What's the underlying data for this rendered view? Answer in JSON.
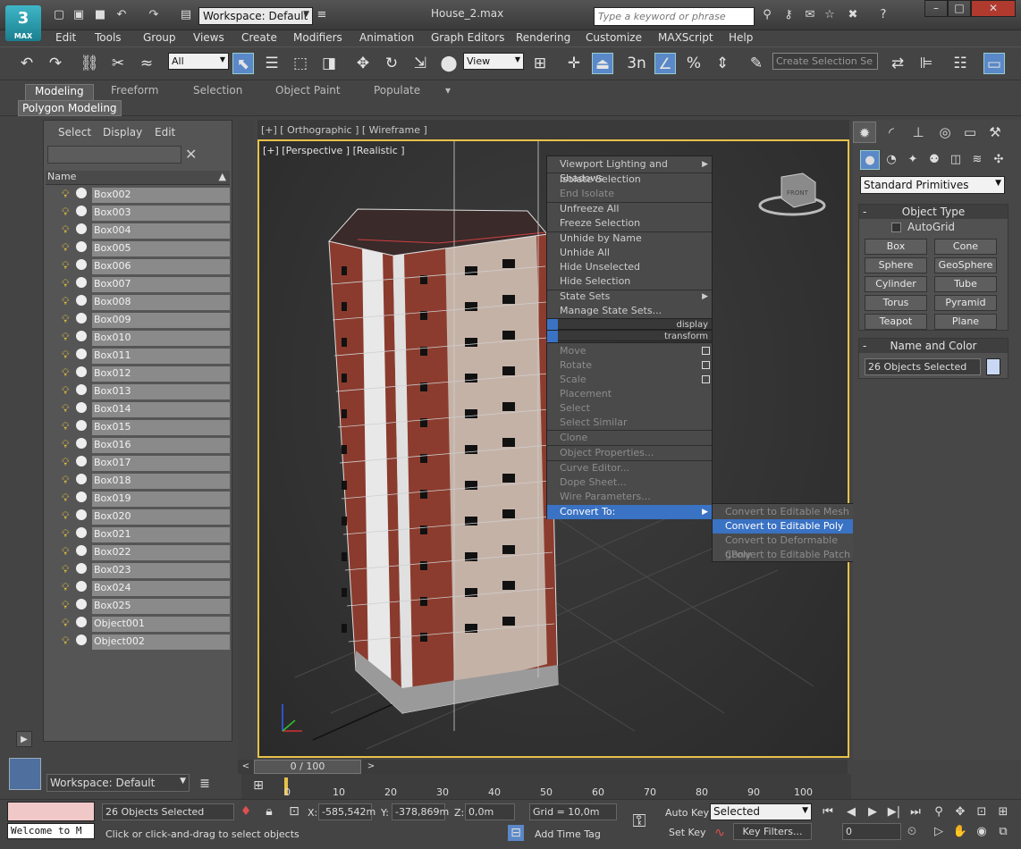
{
  "app": {
    "logo_text": "3",
    "logo_sub": "MAX",
    "workspace": "Workspace: Default",
    "document_title": "House_2.max",
    "search_placeholder": "Type a keyword or phrase",
    "colors": {
      "accent": "#5a88c8",
      "viewport_border": "#e8c14a",
      "menu_highlight": "#3a72c4"
    }
  },
  "menu": [
    "Edit",
    "Tools",
    "Group",
    "Views",
    "Create",
    "Modifiers",
    "Animation",
    "Graph Editors",
    "Rendering",
    "Customize",
    "MAXScript",
    "Help"
  ],
  "toolbar": {
    "filter_value": "All",
    "reference_coord": "View",
    "spinner_snap_label": "3n",
    "selection_set_placeholder": "Create Selection Se"
  },
  "ribbon": {
    "tabs": [
      "Modeling",
      "Freeform",
      "Selection",
      "Object Paint",
      "Populate"
    ],
    "active_tab": "Modeling",
    "panel_label": "Polygon Modeling"
  },
  "explorer": {
    "menu": [
      "Select",
      "Display",
      "Edit"
    ],
    "column_header": "Name",
    "items": [
      "Box002",
      "Box003",
      "Box004",
      "Box005",
      "Box006",
      "Box007",
      "Box008",
      "Box009",
      "Box010",
      "Box011",
      "Box012",
      "Box013",
      "Box014",
      "Box015",
      "Box016",
      "Box017",
      "Box018",
      "Box019",
      "Box020",
      "Box021",
      "Box022",
      "Box023",
      "Box024",
      "Box025",
      "Object001",
      "Object002"
    ],
    "workspace": "Workspace: Default"
  },
  "viewports": {
    "top_label": "[+] [ Orthographic ] [ Wireframe ]",
    "main_label": "[+] [Perspective ] [Realistic ]",
    "viewcube_text": "FRONT"
  },
  "quad_menu": {
    "display": {
      "items": [
        "Viewport Lighting and Shadows",
        "Isolate Selection",
        "End Isolate",
        "Unfreeze All",
        "Freeze Selection",
        "Unhide by Name",
        "Unhide All",
        "Hide Unselected",
        "Hide Selection",
        "State Sets",
        "Manage State Sets..."
      ],
      "section_label": "display"
    },
    "transform": {
      "section_label": "transform",
      "items": [
        "Move",
        "Rotate",
        "Scale",
        "Placement",
        "Select",
        "Select Similar",
        "Clone",
        "Object Properties...",
        "Curve Editor...",
        "Dope Sheet...",
        "Wire Parameters...",
        "Convert To:"
      ]
    },
    "submenu": [
      "Convert to Editable Mesh",
      "Convert to Editable Poly",
      "Convert to Deformable gPoly",
      "Convert to Editable Patch"
    ],
    "highlighted": "Convert to Editable Poly"
  },
  "command_panel": {
    "category": "Standard Primitives",
    "object_type_title": "Object Type",
    "autogrid_label": "AutoGrid",
    "primitives": [
      "Box",
      "Cone",
      "Sphere",
      "GeoSphere",
      "Cylinder",
      "Tube",
      "Torus",
      "Pyramid",
      "Teapot",
      "Plane"
    ],
    "name_color_title": "Name and Color",
    "name_field": "26 Objects Selected",
    "object_color": "#c8d8f4"
  },
  "timeline": {
    "frame_display": "0 / 100",
    "ticks": [
      "0",
      "10",
      "20",
      "30",
      "40",
      "50",
      "60",
      "70",
      "80",
      "90",
      "100"
    ]
  },
  "status": {
    "maxscript_input": "Welcome to M",
    "selection_count": "26 Objects Selected",
    "prompt": "Click or click-and-drag to select objects",
    "x_label": "X:",
    "x_value": "-585,542m",
    "y_label": "Y:",
    "y_value": "-378,869m",
    "z_label": "Z:",
    "z_value": "0,0m",
    "grid": "Grid = 10,0m",
    "add_time_tag": "Add Time Tag",
    "auto_key": "Auto Key",
    "set_key": "Set Key",
    "key_mode": "Selected",
    "key_filters": "Key Filters...",
    "current_frame": "0"
  }
}
